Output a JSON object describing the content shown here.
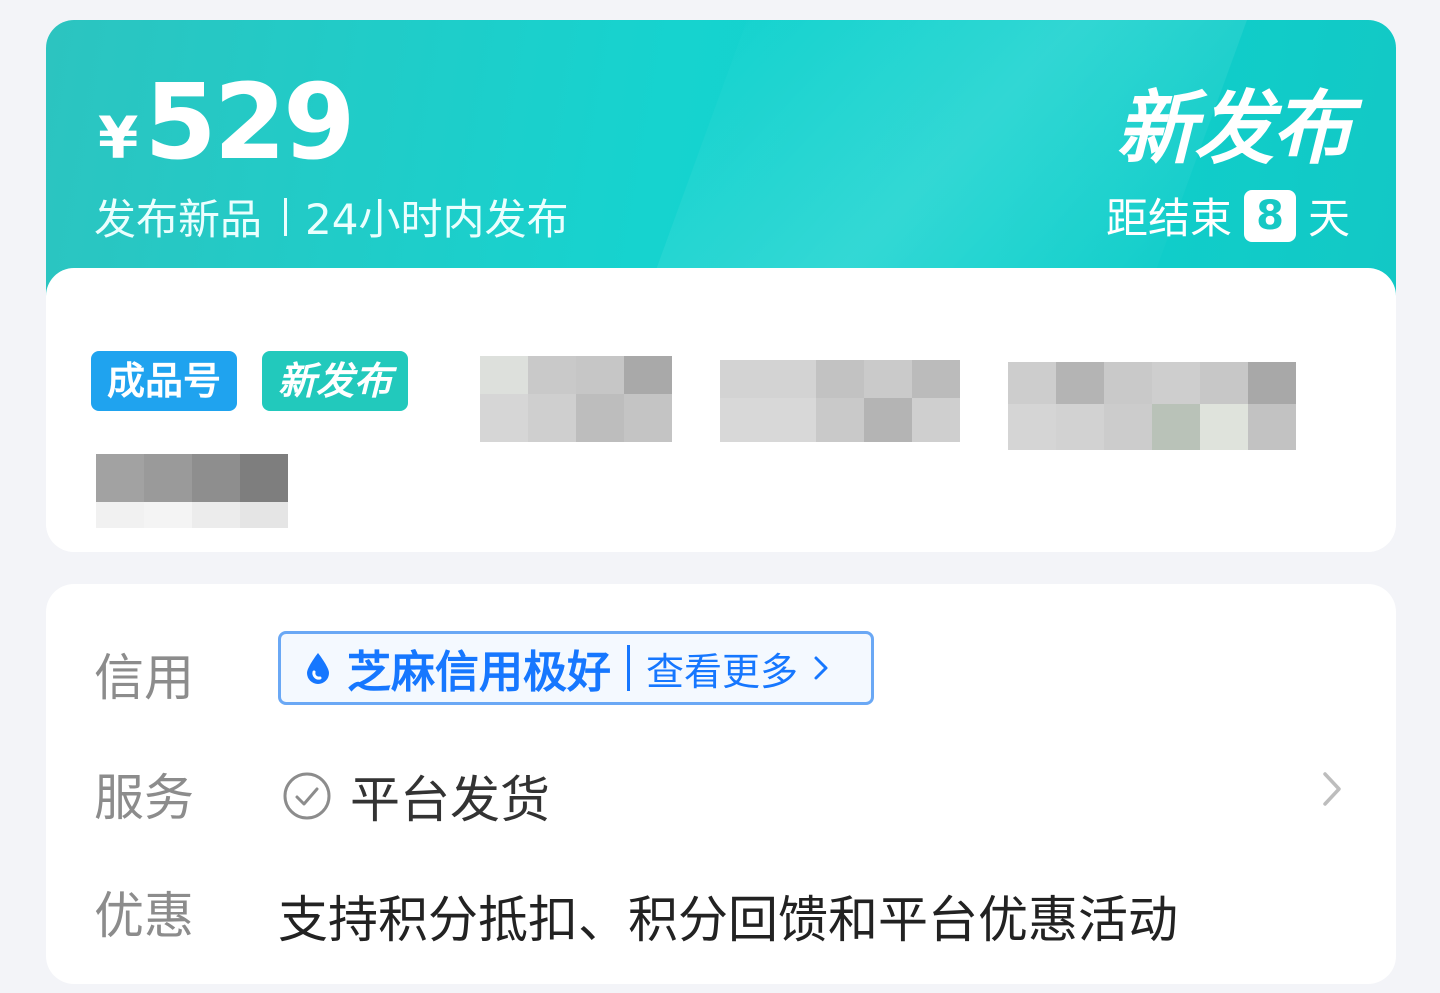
{
  "banner": {
    "currency": "¥",
    "price": "529",
    "subtitle_left": "发布新品",
    "subtitle_right": "24小时内发布",
    "tagline": "新发布",
    "countdown_prefix": "距结束",
    "countdown_days": "8",
    "countdown_suffix": "天",
    "colors": {
      "primary": "#17c8c4",
      "white": "#ffffff"
    }
  },
  "listing": {
    "badges": [
      "成品号",
      "新发布"
    ],
    "badge_colors": [
      "#1fa3ef",
      "#22c9bc"
    ]
  },
  "details": {
    "credit": {
      "label": "信用",
      "badge_text": "芝麻信用极好",
      "more_link": "查看更多",
      "icon": "sesame-drop-icon",
      "accent": "#1677ff"
    },
    "service": {
      "label": "服务",
      "text": "平台发货",
      "icon": "check-circle-icon"
    },
    "promo": {
      "label": "优惠",
      "text": "支持积分抵扣、积分回馈和平台优惠活动"
    }
  }
}
